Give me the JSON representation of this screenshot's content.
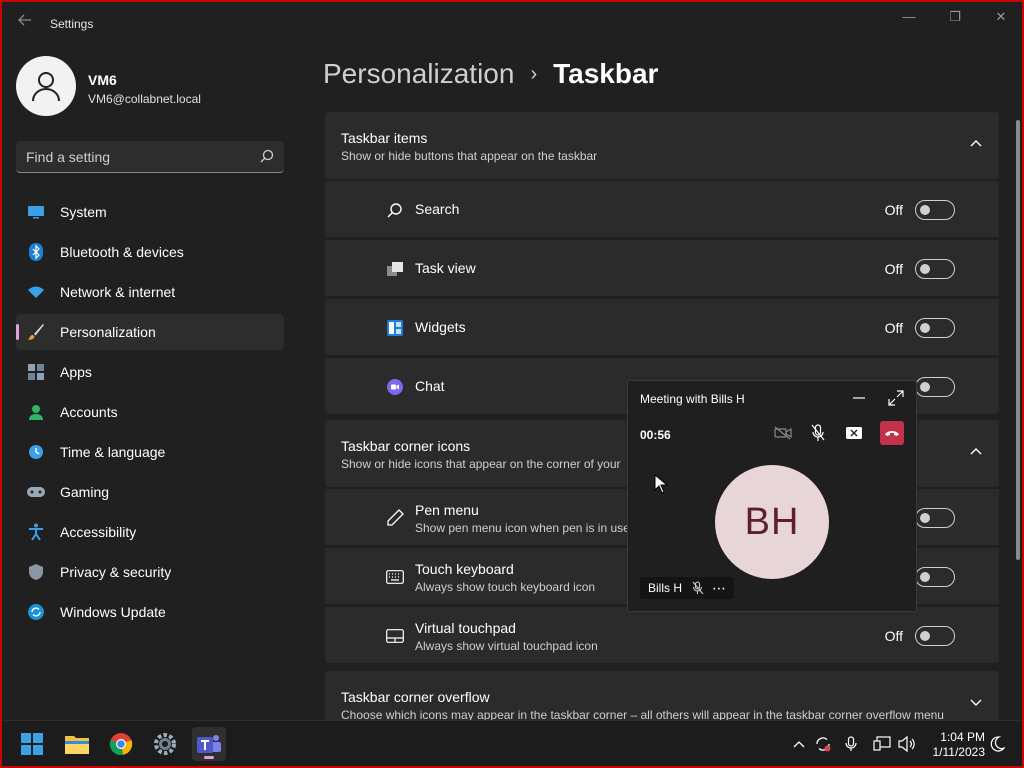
{
  "window": {
    "title": "Settings",
    "controls": {
      "minimize": "—",
      "restore": "❐",
      "close": "✕"
    }
  },
  "profile": {
    "name": "VM6",
    "email": "VM6@collabnet.local"
  },
  "search": {
    "placeholder": "Find a setting"
  },
  "sidebar": {
    "items": [
      {
        "label": "System",
        "icon": "system-icon"
      },
      {
        "label": "Bluetooth & devices",
        "icon": "bluetooth-icon"
      },
      {
        "label": "Network & internet",
        "icon": "wifi-icon"
      },
      {
        "label": "Personalization",
        "icon": "brush-icon",
        "active": true
      },
      {
        "label": "Apps",
        "icon": "apps-icon"
      },
      {
        "label": "Accounts",
        "icon": "accounts-icon"
      },
      {
        "label": "Time & language",
        "icon": "clock-globe-icon"
      },
      {
        "label": "Gaming",
        "icon": "gamepad-icon"
      },
      {
        "label": "Accessibility",
        "icon": "accessibility-icon"
      },
      {
        "label": "Privacy & security",
        "icon": "shield-icon"
      },
      {
        "label": "Windows Update",
        "icon": "update-icon"
      }
    ]
  },
  "breadcrumb": {
    "parent": "Personalization",
    "separator": "›",
    "current": "Taskbar"
  },
  "sections": {
    "taskbar_items": {
      "title": "Taskbar items",
      "description": "Show or hide buttons that appear on the taskbar",
      "rows": [
        {
          "label": "Search",
          "state": "Off",
          "icon": "search-icon"
        },
        {
          "label": "Task view",
          "state": "Off",
          "icon": "task-view-icon"
        },
        {
          "label": "Widgets",
          "state": "Off",
          "icon": "widgets-icon"
        },
        {
          "label": "Chat",
          "state": "",
          "icon": "chat-icon"
        }
      ]
    },
    "corner_icons": {
      "title": "Taskbar corner icons",
      "description": "Show or hide icons that appear on the corner of your",
      "rows": [
        {
          "label": "Pen menu",
          "sub": "Show pen menu icon when pen is in use",
          "state": "",
          "icon": "pen-icon"
        },
        {
          "label": "Touch keyboard",
          "sub": "Always show touch keyboard icon",
          "state": "",
          "icon": "keyboard-icon"
        },
        {
          "label": "Virtual touchpad",
          "sub": "Always show virtual touchpad icon",
          "state": "Off",
          "icon": "touchpad-icon"
        }
      ]
    },
    "corner_overflow": {
      "title": "Taskbar corner overflow",
      "description": "Choose which icons may appear in the taskbar corner – all others will appear in the taskbar corner overflow menu"
    }
  },
  "meeting": {
    "title": "Meeting with Bills H",
    "timer": "00:56",
    "initials": "BH",
    "participant": "Bills H",
    "more": "⋯"
  },
  "taskbar": {
    "apps": [
      "start-icon",
      "file-explorer-icon",
      "chrome-icon",
      "settings-icon",
      "teams-icon"
    ],
    "time": "1:04 PM",
    "date": "1/11/2023"
  },
  "colors": {
    "accent": "#e19fda",
    "background": "#202020",
    "card": "#2b2b2b",
    "end_call": "#c4314b",
    "avatar_bg": "#e8d5d8",
    "avatar_text": "#5b1f2d"
  }
}
